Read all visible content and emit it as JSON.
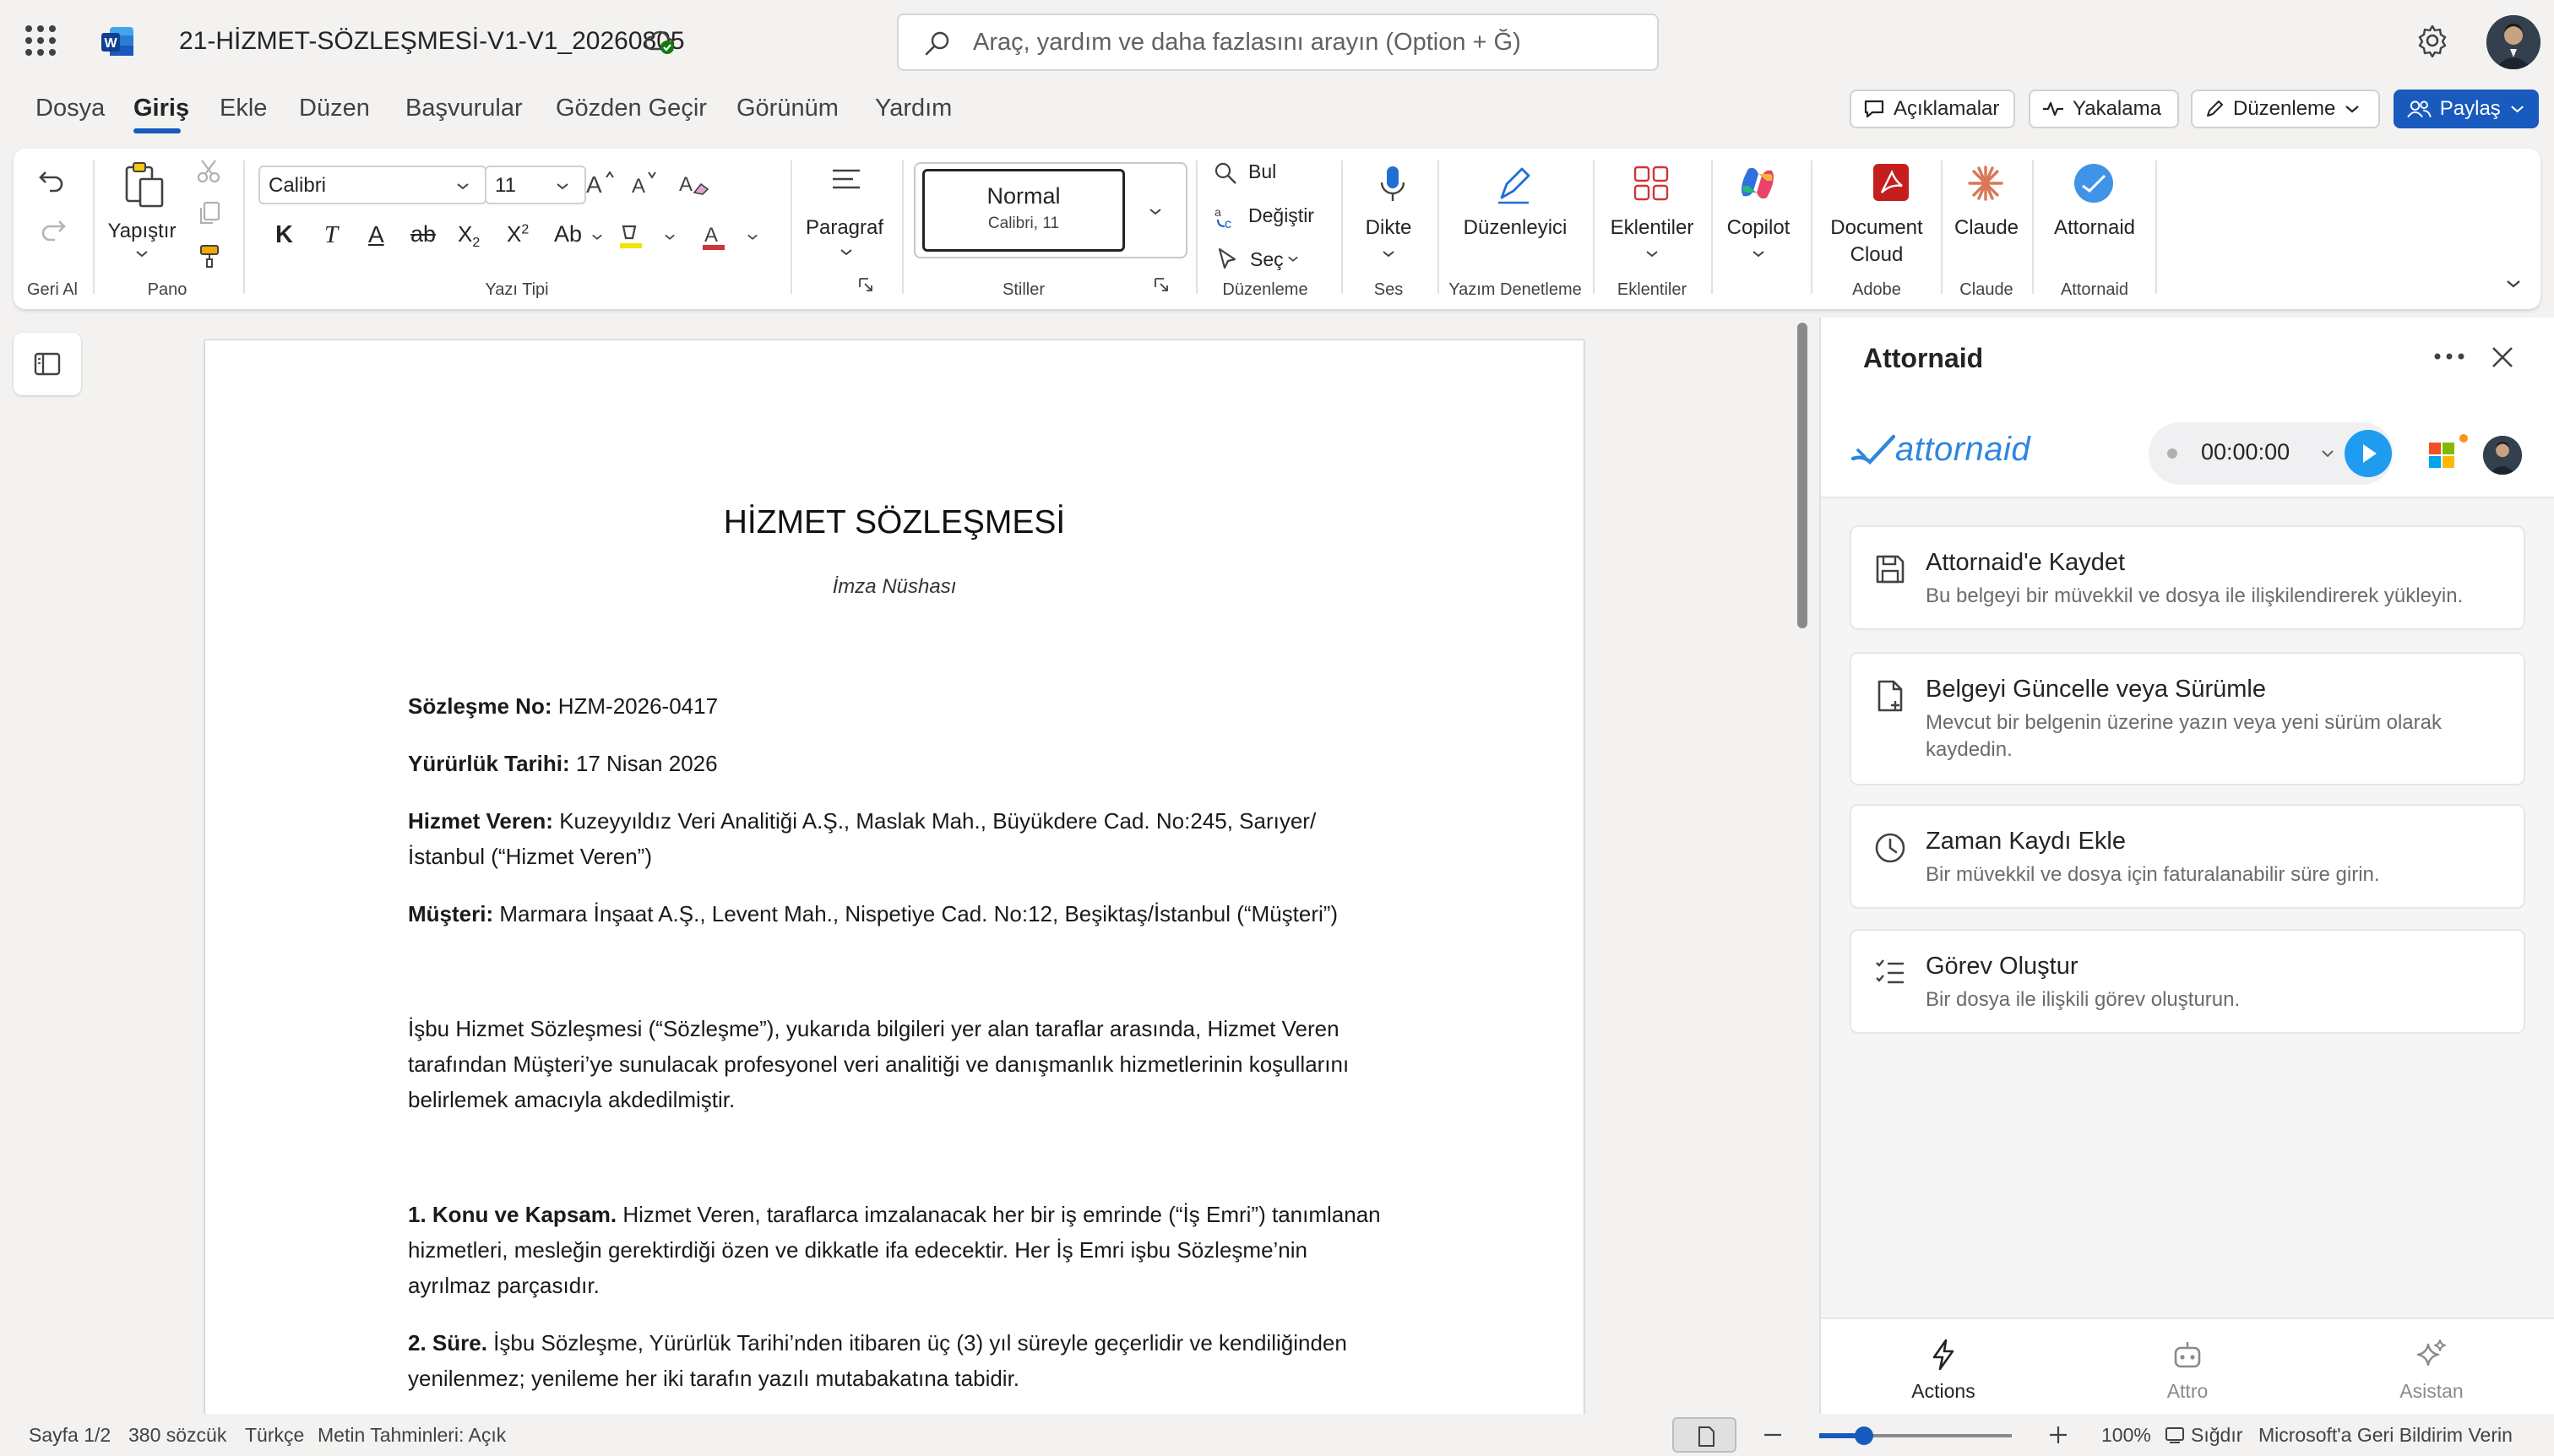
{
  "app": {
    "doc_title": "21-HİZMET-SÖZLEŞMESİ-V1-V1_20260805",
    "search_placeholder": "Araç, yardım ve daha fazlasını arayın (Option + Ğ)"
  },
  "menu": {
    "tabs": [
      "Dosya",
      "Giriş",
      "Ekle",
      "Düzen",
      "Başvurular",
      "Gözden Geçir",
      "Görünüm",
      "Yardım"
    ],
    "active_tab": "Giriş",
    "comments": "Açıklamalar",
    "catchup": "Yakalama",
    "editing": "Düzenleme",
    "share": "Paylaş"
  },
  "ribbon": {
    "undo_group": "Geri Al",
    "paste": "Yapıştır",
    "clipboard_group": "Pano",
    "font_name": "Calibri",
    "font_size": "11",
    "font_group": "Yazı Tipi",
    "paragraph": "Paragraf",
    "style_normal": "Normal",
    "style_normal_sub": "Calibri, 11",
    "styles_group": "Stiller",
    "find": "Bul",
    "replace": "Değiştir",
    "select": "Seç",
    "editing_group": "Düzenleme",
    "dictate": "Dikte",
    "voice_group": "Ses",
    "editor": "Düzenleyici",
    "proofing_group": "Yazım Denetleme",
    "addins": "Eklentiler",
    "addins_group": "Eklentiler",
    "copilot": "Copilot",
    "doc_cloud_1": "Document",
    "doc_cloud_2": "Cloud",
    "adobe_group": "Adobe",
    "claude": "Claude",
    "claude_group": "Claude",
    "attornaid": "Attornaid",
    "attornaid_group": "Attornaid"
  },
  "document": {
    "heading": "HİZMET SÖZLEŞMESİ",
    "subheading": "İmza Nüshası",
    "contract_no_label": "Sözleşme No:",
    "contract_no": "HZM-2026-0417",
    "effective_label": "Yürürlük Tarihi:",
    "effective_date": "17 Nisan 2026",
    "provider_label": "Hizmet Veren:",
    "provider": "Kuzeyyıldız Veri Analitiği A.Ş., Maslak Mah., Büyükdere Cad. No:245, Sarıyer/İstanbul (“Hizmet Veren”)",
    "client_label": "Müşteri:",
    "client": "Marmara İnşaat A.Ş., Levent Mah., Nispetiye Cad. No:12, Beşiktaş/İstanbul (“Müşteri”)",
    "intro": "İşbu Hizmet Sözleşmesi (“Sözleşme”), yukarıda bilgileri yer alan taraflar arasında, Hizmet Veren tarafından Müşteri’ye sunulacak profesyonel veri analitiği ve danışmanlık hizmetlerinin koşullarını belirlemek amacıyla akdedilmiştir.",
    "s1_title": "1. Konu ve Kapsam.",
    "s1_body": "Hizmet Veren, taraflarca imzalanacak her bir iş emrinde (“İş Emri”) tanımlanan hizmetleri, mesleğin gerektirdiği özen ve dikkatle ifa edecektir. Her İş Emri işbu Sözleşme’nin ayrılmaz parçasıdır.",
    "s2_title": "2. Süre.",
    "s2_body": "İşbu Sözleşme, Yürürlük Tarihi’nden itibaren üç (3) yıl süreyle geçerlidir ve kendiliğinden yenilenmez; yenileme her iki tarafın yazılı mutabakatına tabidir."
  },
  "panel": {
    "title": "Attornaid",
    "logo_text": "attornaid",
    "timer": "00:00:00",
    "actions": [
      {
        "title": "Attornaid'e Kaydet",
        "desc": "Bu belgeyi bir müvekkil ve dosya ile ilişkilendirerek yükleyin.",
        "icon": "save-icon"
      },
      {
        "title": "Belgeyi Güncelle veya Sürümle",
        "desc": "Mevcut bir belgenin üzerine yazın veya yeni sürüm olarak kaydedin.",
        "icon": "document-add-icon"
      },
      {
        "title": "Zaman Kaydı Ekle",
        "desc": "Bir müvekkil ve dosya için faturalanabilir süre girin.",
        "icon": "clock-icon"
      },
      {
        "title": "Görev Oluştur",
        "desc": "Bir dosya ile ilişkili görev oluşturun.",
        "icon": "task-list-icon"
      }
    ],
    "tabs": [
      {
        "label": "Actions",
        "icon": "lightning-icon",
        "active": true
      },
      {
        "label": "Attro",
        "icon": "robot-icon",
        "active": false
      },
      {
        "label": "Asistan",
        "icon": "sparkle-icon",
        "active": false
      }
    ]
  },
  "status": {
    "page": "Sayfa 1/2",
    "words": "380 sözcük",
    "language": "Türkçe",
    "predictions": "Metin Tahminleri: Açık",
    "zoom": "100%",
    "fit": "Sığdır",
    "feedback": "Microsoft'a Geri Bildirim Verin"
  },
  "colors": {
    "accent": "#185abd",
    "attornaid_blue": "#2f86e0",
    "play_blue": "#1f9bf0"
  }
}
